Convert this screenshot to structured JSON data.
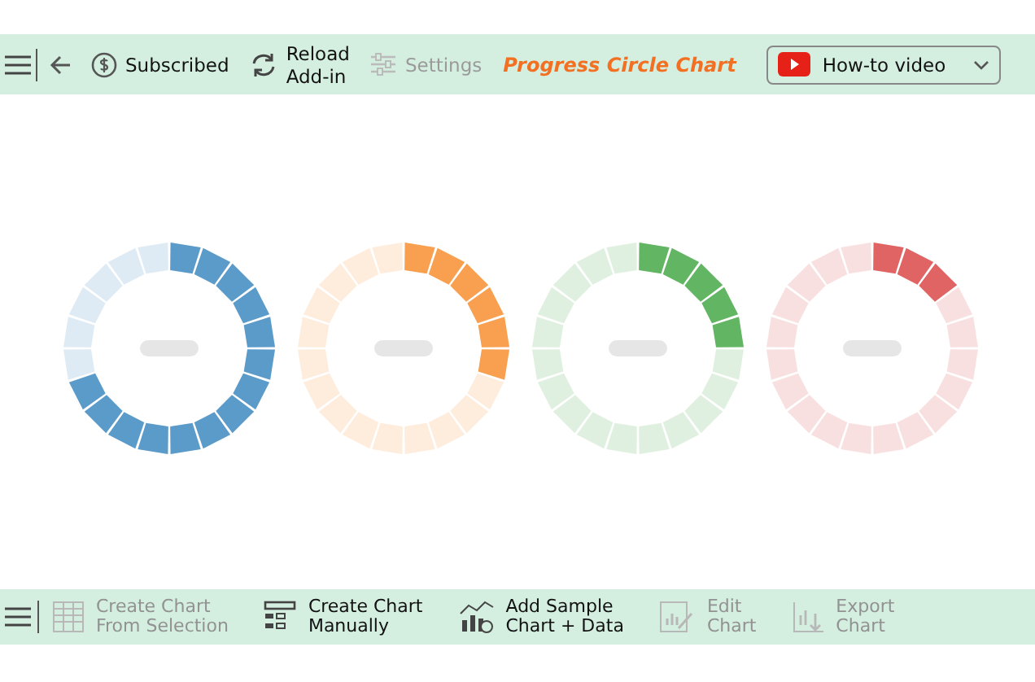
{
  "toolbar": {
    "buttons": [
      {
        "kind": "dollar",
        "lines": [
          "Subscribed"
        ],
        "disabled": false
      },
      {
        "kind": "reload",
        "lines": [
          "Reload",
          "Add-in"
        ],
        "disabled": false
      },
      {
        "kind": "sliders",
        "lines": [
          "Settings"
        ],
        "disabled": true
      }
    ],
    "title": "Progress Circle Chart",
    "video_dropdown": {
      "label": "How-to video"
    }
  },
  "charts": [
    {
      "color": "#5b9bc9",
      "segments": [
        {
          "filled": true
        },
        {
          "filled": true
        },
        {
          "filled": true
        },
        {
          "filled": true
        },
        {
          "filled": true
        },
        {
          "filled": true
        },
        {
          "filled": true
        },
        {
          "filled": true
        },
        {
          "filled": true
        },
        {
          "filled": true
        },
        {
          "filled": true
        },
        {
          "filled": true
        },
        {
          "filled": true
        },
        {
          "filled": true
        },
        {
          "filled": false
        },
        {
          "filled": false
        },
        {
          "filled": false
        },
        {
          "filled": false
        },
        {
          "filled": false
        },
        {
          "filled": false
        }
      ]
    },
    {
      "color": "#f9a050",
      "segments": [
        {
          "filled": true
        },
        {
          "filled": true
        },
        {
          "filled": true
        },
        {
          "filled": true
        },
        {
          "filled": true
        },
        {
          "filled": true
        },
        {
          "filled": false
        },
        {
          "filled": false
        },
        {
          "filled": false
        },
        {
          "filled": false
        },
        {
          "filled": false
        },
        {
          "filled": false
        },
        {
          "filled": false
        },
        {
          "filled": false
        },
        {
          "filled": false
        },
        {
          "filled": false
        },
        {
          "filled": false
        },
        {
          "filled": false
        },
        {
          "filled": false
        },
        {
          "filled": false
        }
      ]
    },
    {
      "color": "#62b562",
      "segments": [
        {
          "filled": true
        },
        {
          "filled": true
        },
        {
          "filled": true
        },
        {
          "filled": true
        },
        {
          "filled": true
        },
        {
          "filled": false
        },
        {
          "filled": false
        },
        {
          "filled": false
        },
        {
          "filled": false
        },
        {
          "filled": false
        },
        {
          "filled": false
        },
        {
          "filled": false
        },
        {
          "filled": false
        },
        {
          "filled": false
        },
        {
          "filled": false
        },
        {
          "filled": false
        },
        {
          "filled": false
        },
        {
          "filled": false
        },
        {
          "filled": false
        },
        {
          "filled": false
        }
      ]
    },
    {
      "color": "#e06464",
      "segments": [
        {
          "filled": true
        },
        {
          "filled": true
        },
        {
          "filled": true
        },
        {
          "filled": false
        },
        {
          "filled": false
        },
        {
          "filled": false
        },
        {
          "filled": false
        },
        {
          "filled": false
        },
        {
          "filled": false
        },
        {
          "filled": false
        },
        {
          "filled": false
        },
        {
          "filled": false
        },
        {
          "filled": false
        },
        {
          "filled": false
        },
        {
          "filled": false
        },
        {
          "filled": false
        },
        {
          "filled": false
        },
        {
          "filled": false
        },
        {
          "filled": false
        },
        {
          "filled": false
        }
      ]
    }
  ],
  "bottom_bar": {
    "buttons": [
      {
        "kind": "table",
        "lines": [
          "Create Chart",
          "From Selection"
        ],
        "disabled": true
      },
      {
        "kind": "form",
        "lines": [
          "Create Chart",
          "Manually"
        ],
        "disabled": false
      },
      {
        "kind": "sample",
        "lines": [
          "Add Sample",
          "Chart + Data"
        ],
        "disabled": false
      },
      {
        "kind": "edit",
        "lines": [
          "Edit",
          "Chart"
        ],
        "disabled": true
      },
      {
        "kind": "export",
        "lines": [
          "Export",
          "Chart"
        ],
        "disabled": true
      }
    ]
  }
}
